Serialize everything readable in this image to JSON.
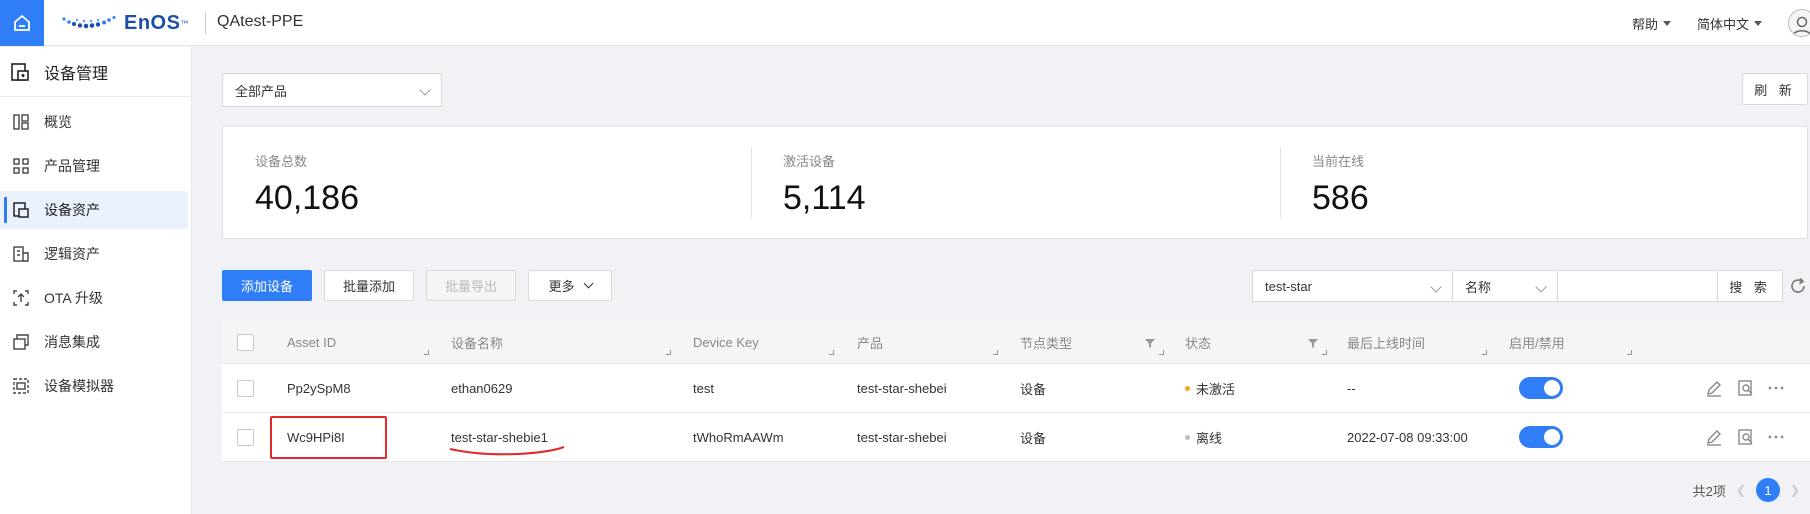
{
  "header": {
    "brand": "EnOS",
    "brand_tm": "™",
    "app_name": "QAtest-PPE",
    "help_label": "帮助",
    "language_label": "简体中文"
  },
  "sidebar": {
    "title": "设备管理",
    "items": [
      {
        "label": "概览",
        "icon": "overview-icon",
        "active": false
      },
      {
        "label": "产品管理",
        "icon": "product-icon",
        "active": false
      },
      {
        "label": "设备资产",
        "icon": "device-asset-icon",
        "active": true
      },
      {
        "label": "逻辑资产",
        "icon": "logic-asset-icon",
        "active": false
      },
      {
        "label": "OTA 升级",
        "icon": "ota-icon",
        "active": false
      },
      {
        "label": "消息集成",
        "icon": "message-icon",
        "active": false
      },
      {
        "label": "设备模拟器",
        "icon": "simulator-icon",
        "active": false
      }
    ]
  },
  "product_select": {
    "value": "全部产品"
  },
  "refresh_label": "刷 新",
  "stats": [
    {
      "label": "设备总数",
      "value": "40,186"
    },
    {
      "label": "激活设备",
      "value": "5,114"
    },
    {
      "label": "当前在线",
      "value": "586"
    }
  ],
  "actions": {
    "add": "添加设备",
    "batch_add": "批量添加",
    "batch_export": "批量导出",
    "more": "更多"
  },
  "search": {
    "product_value": "test-star",
    "field_value": "名称",
    "keyword": "",
    "button": "搜 索"
  },
  "table": {
    "columns": [
      "Asset ID",
      "设备名称",
      "Device Key",
      "产品",
      "节点类型",
      "状态",
      "最后上线时间",
      "启用/禁用"
    ],
    "rows": [
      {
        "asset_id": "Pp2ySpM8",
        "name": "ethan0629",
        "device_key": "test",
        "product": "test-star-shebei",
        "node_type": "设备",
        "status": "未激活",
        "status_color": "#f5a623",
        "last_online": "--",
        "enabled": true
      },
      {
        "asset_id": "Wc9HPi8I",
        "name": "test-star-shebie1",
        "device_key": "tWhoRmAAWm",
        "product": "test-star-shebei",
        "node_type": "设备",
        "status": "离线",
        "status_color": "#bfbfbf",
        "last_online": "2022-07-08 09:33:00",
        "enabled": true
      }
    ]
  },
  "pagination": {
    "total_label": "共2项",
    "current_page": "1"
  },
  "colors": {
    "accent": "#2f7ef7",
    "annotation": "#e42828"
  }
}
